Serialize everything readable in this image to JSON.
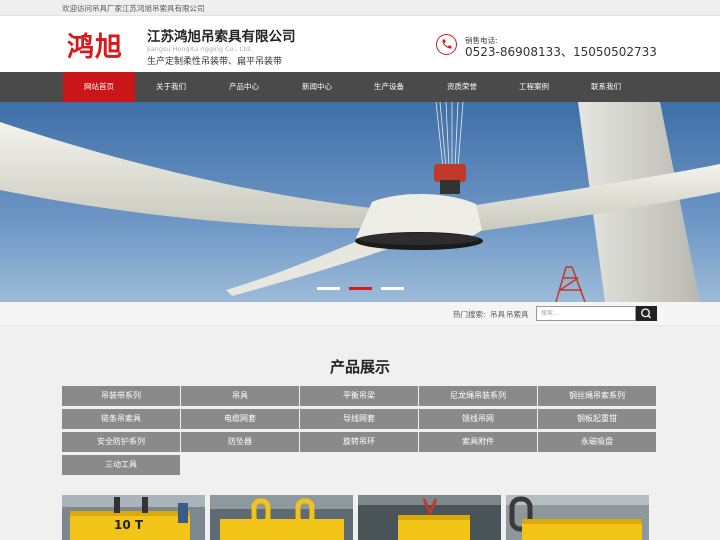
{
  "topbar": {
    "welcome": "欢迎访问吊具厂家江苏鸿旭吊索具有限公司"
  },
  "header": {
    "logo": "鸿旭",
    "company_name": "江苏鸿旭吊索具有限公司",
    "company_en": "Jiangsu HongXu rigging Co., Ltd.",
    "slogan": "生产定制柔性吊装带、扁平吊装带",
    "phone_icon": "phone-icon",
    "phone_label": "销售电话:",
    "phone_number": "0523-86908133、15050502733"
  },
  "nav": {
    "items": [
      {
        "label": "网站首页",
        "active": true
      },
      {
        "label": "关于我们"
      },
      {
        "label": "产品中心"
      },
      {
        "label": "新闻中心"
      },
      {
        "label": "生产设备"
      },
      {
        "label": "资质荣誉"
      },
      {
        "label": "工程案例"
      },
      {
        "label": "联系我们"
      }
    ],
    "active_color": "#cb1619"
  },
  "banner": {
    "slides": 3,
    "active_index": 1
  },
  "search": {
    "hot_label": "热门搜索:",
    "keywords": [
      "吊具",
      "吊索具"
    ],
    "placeholder": "搜索...",
    "button_icon": "search-icon"
  },
  "products": {
    "title": "产品展示",
    "categories": [
      "吊装带系列",
      "吊具",
      "平衡吊梁",
      "尼龙绳吊装系列",
      "钢丝绳吊索系列",
      "链条吊索具",
      "电缆网套",
      "导线网套",
      "馈线吊网",
      "钢板起重钳",
      "安全防护系列",
      "防坠器",
      "旋转吊环",
      "索具附件",
      "永磁吸盘",
      "三动工具"
    ]
  }
}
